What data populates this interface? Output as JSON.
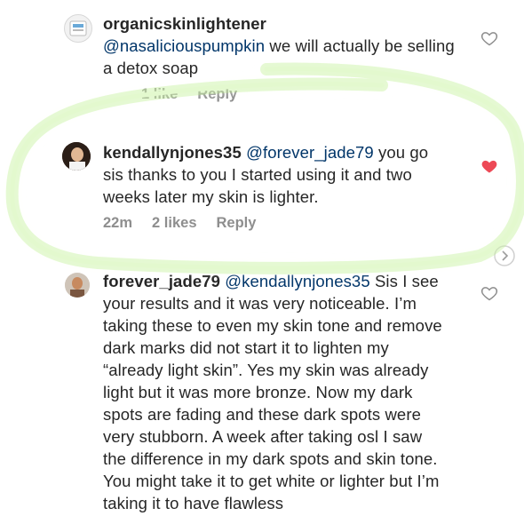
{
  "comments": [
    {
      "username": "organicskinlightener",
      "mention": "@nasaliciouspumpkin",
      "text": " we will actually be selling a detox soap",
      "meta": {
        "time": "",
        "likes": "1 like",
        "reply": "Reply"
      },
      "liked": false
    },
    {
      "username": "kendallynjones35",
      "mention": "@forever_jade79",
      "text": " you go sis thanks to you I started using it and two weeks later my skin is lighter.",
      "meta": {
        "time": "22m",
        "likes": "2 likes",
        "reply": "Reply"
      },
      "liked": true
    },
    {
      "username": "forever_jade79",
      "mention": "@kendallynjones35",
      "text": " Sis I see your results and it was very noticeable. I’m taking these to even my skin tone and remove dark marks did not start it to lighten my “already light skin”. Yes my skin was already light but it was more bronze. Now my dark spots are fading and these dark spots were very stubborn. A week after taking osl I saw the difference in my dark spots and skin tone. You might take it to get white or lighter but I’m taking it to have flawless",
      "liked": false
    }
  ],
  "colors": {
    "heart_liked": "#ed4956",
    "heart_empty": "#8e8e8e",
    "highlight_glow": "#9be564",
    "mention": "#003569",
    "meta": "#8e8e8e"
  },
  "icons": {
    "heart": "heart-icon",
    "more": "chevron-right-circle-icon"
  }
}
